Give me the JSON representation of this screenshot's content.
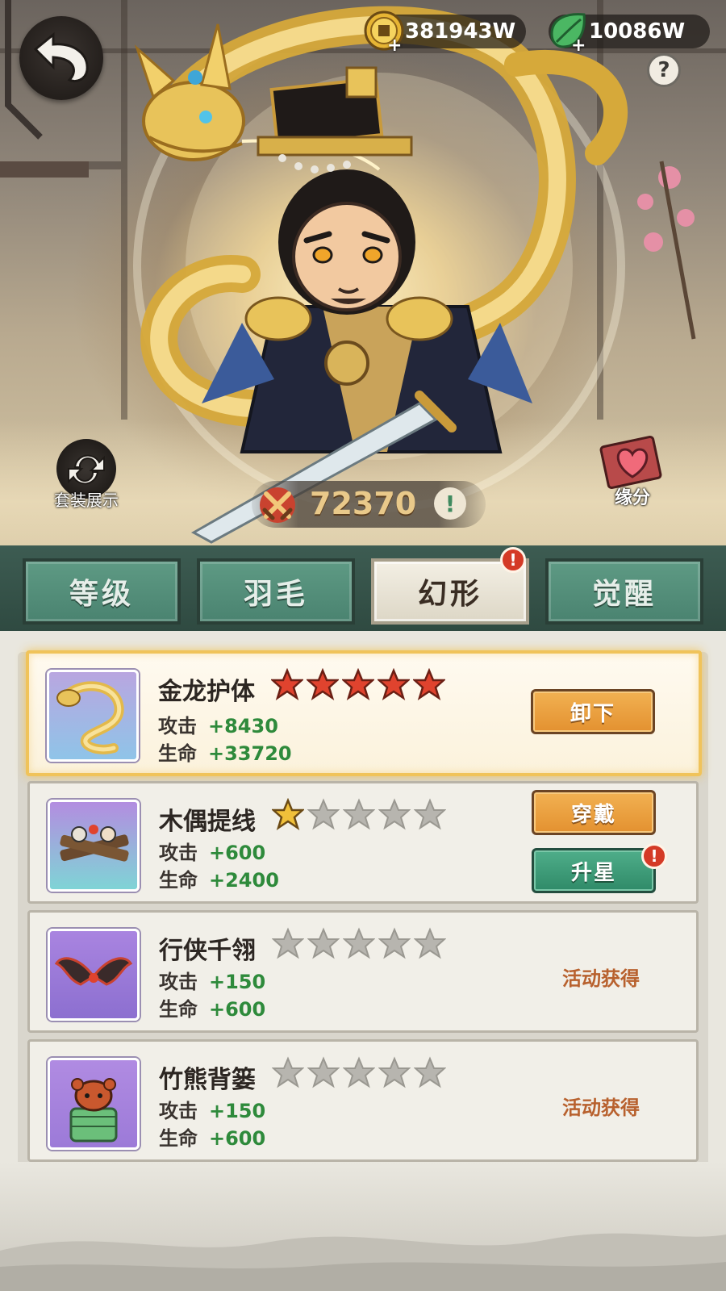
{
  "header": {
    "back_icon": "back-arrow-icon",
    "currency": [
      {
        "icon": "coin-icon",
        "amount": "381943W"
      },
      {
        "icon": "leaf-icon",
        "amount": "10086W"
      }
    ],
    "help_label": "?"
  },
  "hero": {
    "outfit_label": "套装展示",
    "fate_label": "缘分",
    "power_value": "72370",
    "power_info": "!"
  },
  "tabs": [
    {
      "label": "等级",
      "active": false
    },
    {
      "label": "羽毛",
      "active": false
    },
    {
      "label": "幻形",
      "active": true,
      "badge": "!"
    },
    {
      "label": "觉醒",
      "active": false
    }
  ],
  "items": [
    {
      "name": "金龙护体",
      "stars_filled": 5,
      "stars_total": 5,
      "star_color": "#e0432e",
      "atk_label": "攻击",
      "atk_value": "+8430",
      "hp_label": "生命",
      "hp_value": "+33720",
      "action_label": "卸下",
      "selected": true
    },
    {
      "name": "木偶提线",
      "stars_filled": 1,
      "stars_total": 5,
      "star_color": "#f0c03a",
      "atk_label": "攻击",
      "atk_value": "+600",
      "hp_label": "生命",
      "hp_value": "+2400",
      "action_label": "穿戴",
      "upgrade_label": "升星",
      "upgrade_badge": "!"
    },
    {
      "name": "行侠千翎",
      "stars_filled": 0,
      "stars_total": 5,
      "atk_label": "攻击",
      "atk_value": "+150",
      "hp_label": "生命",
      "hp_value": "+600",
      "source_label": "活动获得"
    },
    {
      "name": "竹熊背篓",
      "stars_filled": 0,
      "stars_total": 5,
      "atk_label": "攻击",
      "atk_value": "+150",
      "hp_label": "生命",
      "hp_value": "+600",
      "source_label": "活动获得"
    }
  ],
  "colors": {
    "tab_green": "#4a8370",
    "stat_green": "#2e8a3b",
    "source_orange": "#b8612e",
    "gold_star": "#f0c03a",
    "red_star": "#e0432e",
    "empty_star": "#b7b5af"
  }
}
